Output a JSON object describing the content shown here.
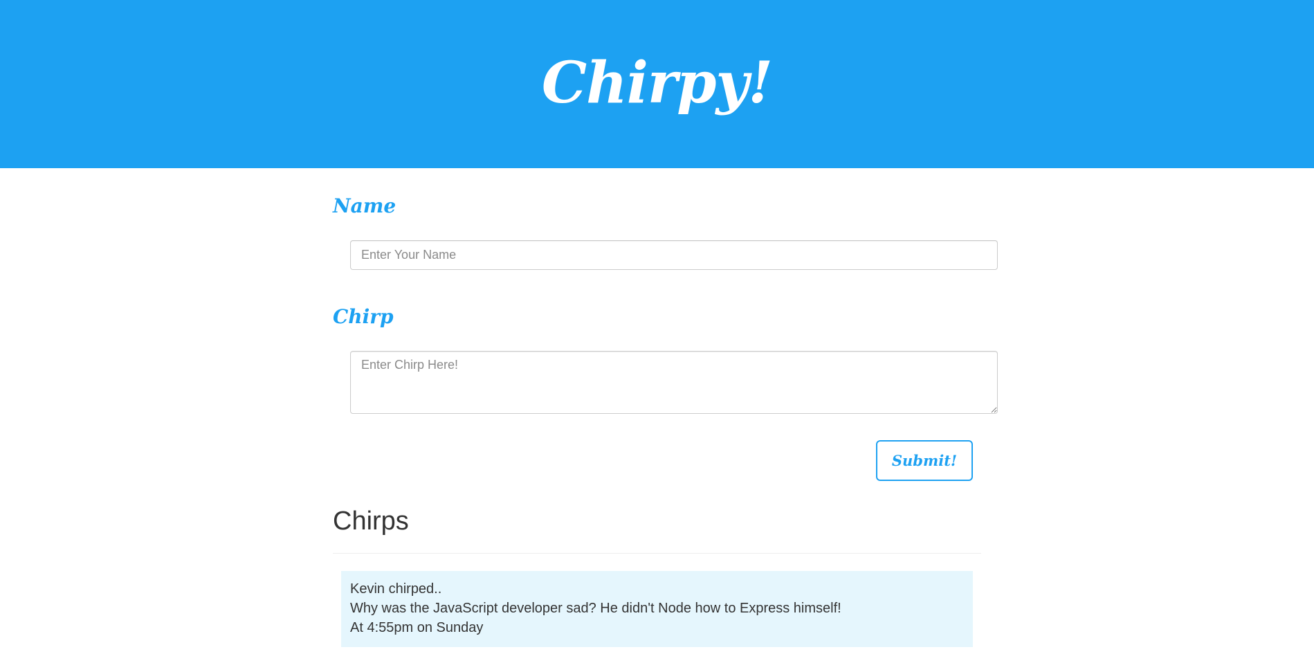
{
  "header": {
    "title": "Chirpy!",
    "color": "#1da1f2"
  },
  "form": {
    "name_label": "Name",
    "name_placeholder": "Enter Your Name",
    "name_value": "",
    "chirp_label": "Chirp",
    "chirp_placeholder": "Enter Chirp Here!",
    "chirp_value": "",
    "submit_label": "Submit!"
  },
  "feed": {
    "title": "Chirps",
    "chirps": [
      {
        "author_line": "Kevin chirped..",
        "text": "Why was the JavaScript developer sad? He didn't Node how to Express himself!",
        "time": "At 4:55pm on Sunday"
      }
    ]
  }
}
